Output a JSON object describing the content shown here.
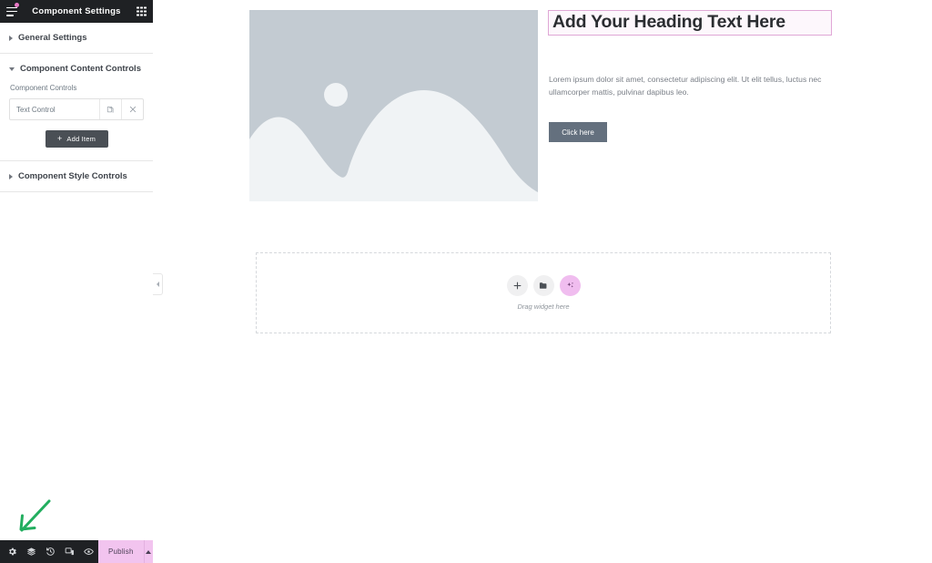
{
  "panel": {
    "header": {
      "title": "Component Settings",
      "menu_icon": "hamburger-menu-icon",
      "apps_icon": "grid-apps-icon",
      "has_notification": true
    },
    "sections": [
      {
        "label": "General Settings",
        "expanded": false
      },
      {
        "label": "Component Content Controls",
        "expanded": true,
        "field_label": "Component Controls",
        "control_item": {
          "name": "Text Control",
          "duplicate_icon": "duplicate-icon",
          "remove_icon": "close-icon"
        },
        "add_item_label": "Add Item",
        "add_item_icon": "plus-icon"
      },
      {
        "label": "Component Style Controls",
        "expanded": false
      }
    ],
    "collapse_icon": "chevron-left-icon"
  },
  "bottom_bar": {
    "icons": [
      {
        "name": "settings-gear-icon",
        "title": "Settings"
      },
      {
        "name": "layers-navigator-icon",
        "title": "Navigator"
      },
      {
        "name": "history-clock-icon",
        "title": "History"
      },
      {
        "name": "responsive-device-icon",
        "title": "Responsive Mode"
      },
      {
        "name": "preview-eye-icon",
        "title": "Preview Changes"
      }
    ],
    "publish_label": "Publish",
    "publish_toggle_icon": "chevron-up-icon",
    "publish_color": "#f2c4ef"
  },
  "canvas": {
    "image_placeholder": {
      "alt": "image-placeholder",
      "sky_color": "#c3cbd2",
      "mountain_color": "#f0f3f5"
    },
    "heading": {
      "text": "Add Your Heading Text Here",
      "selected": true,
      "selection_color": "#e0a7d6"
    },
    "body_text": "Lorem ipsum dolor sit amet, consectetur adipiscing elit. Ut elit tellus, luctus nec ullamcorper mattis, pulvinar dapibus leo.",
    "cta_button": {
      "label": "Click here",
      "color": "#64707e"
    },
    "drop_zone": {
      "label": "Drag widget here",
      "buttons": [
        {
          "name": "add-widget-icon",
          "type": "plus"
        },
        {
          "name": "folder-templates-icon",
          "type": "folder"
        },
        {
          "name": "ai-sparkles-icon",
          "type": "ai"
        }
      ]
    }
  },
  "annotation": {
    "arrow_color": "#22ae5f",
    "points_to": "settings-gear-icon"
  }
}
